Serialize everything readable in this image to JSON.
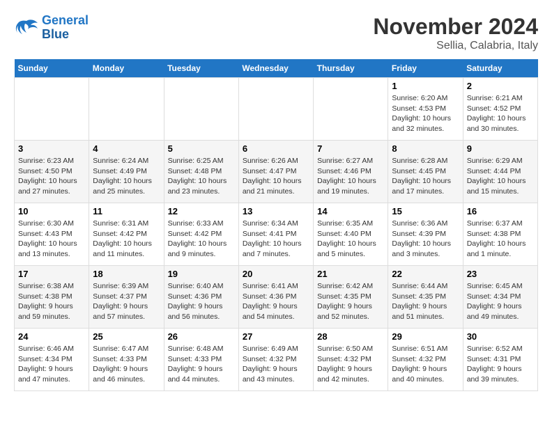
{
  "logo": {
    "line1": "General",
    "line2": "Blue"
  },
  "title": "November 2024",
  "location": "Sellia, Calabria, Italy",
  "days_of_week": [
    "Sunday",
    "Monday",
    "Tuesday",
    "Wednesday",
    "Thursday",
    "Friday",
    "Saturday"
  ],
  "weeks": [
    [
      {
        "num": "",
        "info": ""
      },
      {
        "num": "",
        "info": ""
      },
      {
        "num": "",
        "info": ""
      },
      {
        "num": "",
        "info": ""
      },
      {
        "num": "",
        "info": ""
      },
      {
        "num": "1",
        "info": "Sunrise: 6:20 AM\nSunset: 4:53 PM\nDaylight: 10 hours and 32 minutes."
      },
      {
        "num": "2",
        "info": "Sunrise: 6:21 AM\nSunset: 4:52 PM\nDaylight: 10 hours and 30 minutes."
      }
    ],
    [
      {
        "num": "3",
        "info": "Sunrise: 6:23 AM\nSunset: 4:50 PM\nDaylight: 10 hours and 27 minutes."
      },
      {
        "num": "4",
        "info": "Sunrise: 6:24 AM\nSunset: 4:49 PM\nDaylight: 10 hours and 25 minutes."
      },
      {
        "num": "5",
        "info": "Sunrise: 6:25 AM\nSunset: 4:48 PM\nDaylight: 10 hours and 23 minutes."
      },
      {
        "num": "6",
        "info": "Sunrise: 6:26 AM\nSunset: 4:47 PM\nDaylight: 10 hours and 21 minutes."
      },
      {
        "num": "7",
        "info": "Sunrise: 6:27 AM\nSunset: 4:46 PM\nDaylight: 10 hours and 19 minutes."
      },
      {
        "num": "8",
        "info": "Sunrise: 6:28 AM\nSunset: 4:45 PM\nDaylight: 10 hours and 17 minutes."
      },
      {
        "num": "9",
        "info": "Sunrise: 6:29 AM\nSunset: 4:44 PM\nDaylight: 10 hours and 15 minutes."
      }
    ],
    [
      {
        "num": "10",
        "info": "Sunrise: 6:30 AM\nSunset: 4:43 PM\nDaylight: 10 hours and 13 minutes."
      },
      {
        "num": "11",
        "info": "Sunrise: 6:31 AM\nSunset: 4:42 PM\nDaylight: 10 hours and 11 minutes."
      },
      {
        "num": "12",
        "info": "Sunrise: 6:33 AM\nSunset: 4:42 PM\nDaylight: 10 hours and 9 minutes."
      },
      {
        "num": "13",
        "info": "Sunrise: 6:34 AM\nSunset: 4:41 PM\nDaylight: 10 hours and 7 minutes."
      },
      {
        "num": "14",
        "info": "Sunrise: 6:35 AM\nSunset: 4:40 PM\nDaylight: 10 hours and 5 minutes."
      },
      {
        "num": "15",
        "info": "Sunrise: 6:36 AM\nSunset: 4:39 PM\nDaylight: 10 hours and 3 minutes."
      },
      {
        "num": "16",
        "info": "Sunrise: 6:37 AM\nSunset: 4:38 PM\nDaylight: 10 hours and 1 minute."
      }
    ],
    [
      {
        "num": "17",
        "info": "Sunrise: 6:38 AM\nSunset: 4:38 PM\nDaylight: 9 hours and 59 minutes."
      },
      {
        "num": "18",
        "info": "Sunrise: 6:39 AM\nSunset: 4:37 PM\nDaylight: 9 hours and 57 minutes."
      },
      {
        "num": "19",
        "info": "Sunrise: 6:40 AM\nSunset: 4:36 PM\nDaylight: 9 hours and 56 minutes."
      },
      {
        "num": "20",
        "info": "Sunrise: 6:41 AM\nSunset: 4:36 PM\nDaylight: 9 hours and 54 minutes."
      },
      {
        "num": "21",
        "info": "Sunrise: 6:42 AM\nSunset: 4:35 PM\nDaylight: 9 hours and 52 minutes."
      },
      {
        "num": "22",
        "info": "Sunrise: 6:44 AM\nSunset: 4:35 PM\nDaylight: 9 hours and 51 minutes."
      },
      {
        "num": "23",
        "info": "Sunrise: 6:45 AM\nSunset: 4:34 PM\nDaylight: 9 hours and 49 minutes."
      }
    ],
    [
      {
        "num": "24",
        "info": "Sunrise: 6:46 AM\nSunset: 4:34 PM\nDaylight: 9 hours and 47 minutes."
      },
      {
        "num": "25",
        "info": "Sunrise: 6:47 AM\nSunset: 4:33 PM\nDaylight: 9 hours and 46 minutes."
      },
      {
        "num": "26",
        "info": "Sunrise: 6:48 AM\nSunset: 4:33 PM\nDaylight: 9 hours and 44 minutes."
      },
      {
        "num": "27",
        "info": "Sunrise: 6:49 AM\nSunset: 4:32 PM\nDaylight: 9 hours and 43 minutes."
      },
      {
        "num": "28",
        "info": "Sunrise: 6:50 AM\nSunset: 4:32 PM\nDaylight: 9 hours and 42 minutes."
      },
      {
        "num": "29",
        "info": "Sunrise: 6:51 AM\nSunset: 4:32 PM\nDaylight: 9 hours and 40 minutes."
      },
      {
        "num": "30",
        "info": "Sunrise: 6:52 AM\nSunset: 4:31 PM\nDaylight: 9 hours and 39 minutes."
      }
    ]
  ]
}
